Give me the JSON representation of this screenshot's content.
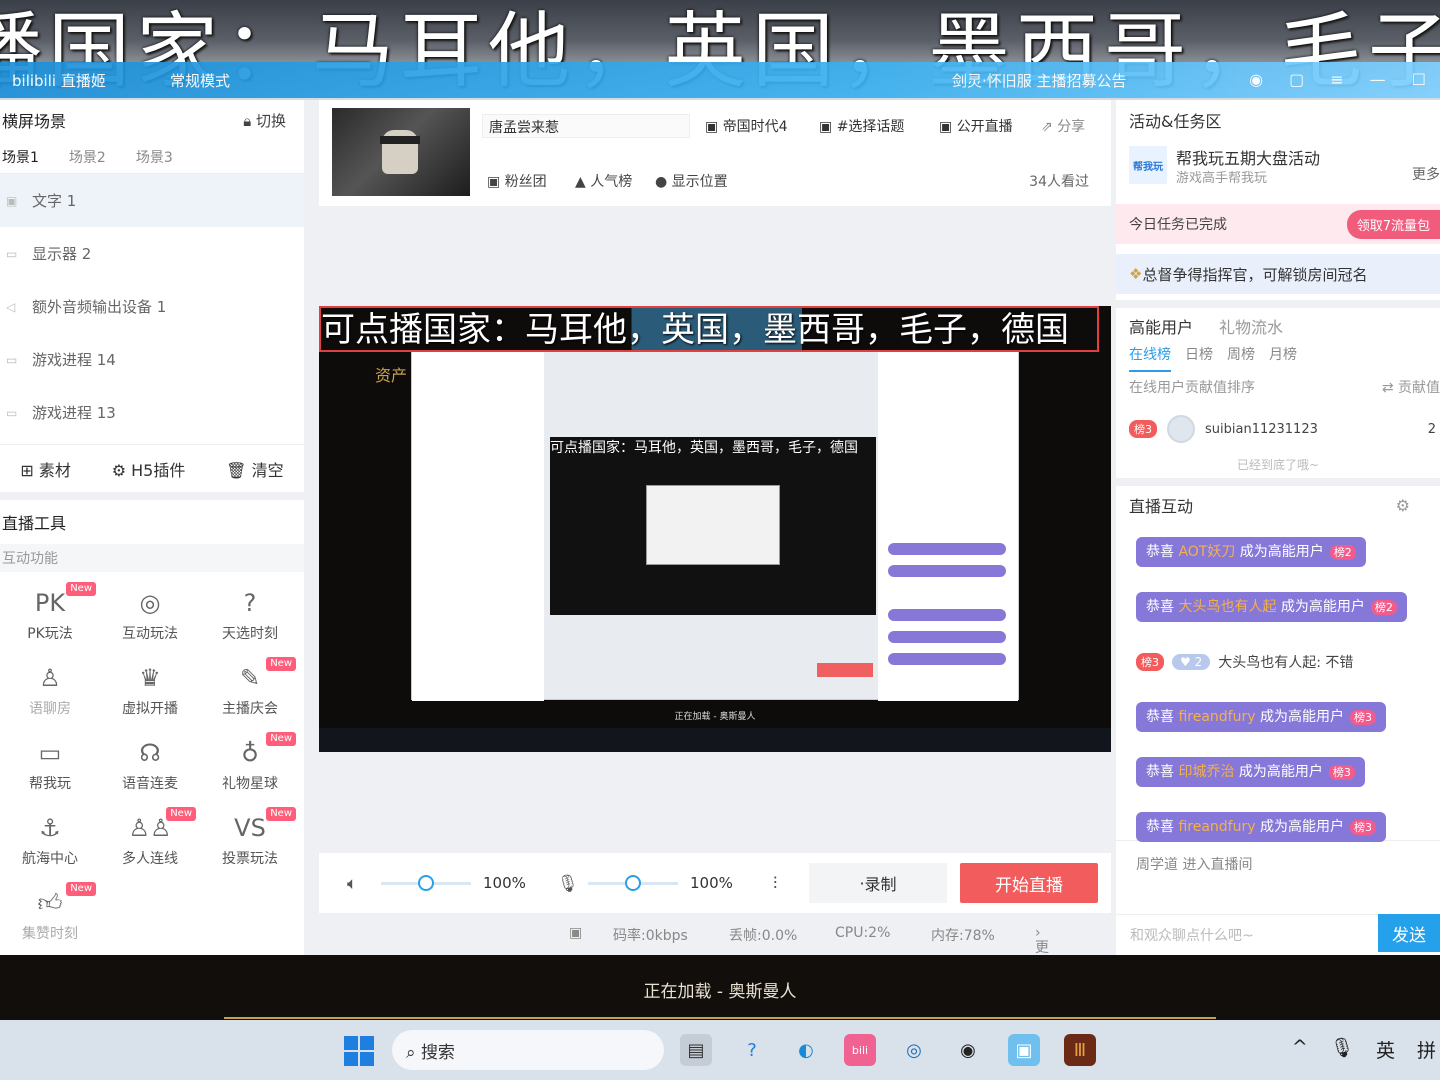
{
  "banner": {
    "text": "播国家：马耳他，英国，墨西哥，毛子，德"
  },
  "titlebar": {
    "app": "bilibili 直播姬",
    "mode": "常规模式",
    "notice": "剑灵·怀旧服 主播招募公告"
  },
  "left": {
    "title": "横屏场景",
    "switch_label": "切换",
    "scenes": [
      "场景1",
      "场景2",
      "场景3"
    ],
    "sources": [
      "文字 1",
      "显示器 2",
      "额外音频输出设备 1",
      "游戏进程 14",
      "游戏进程 13"
    ],
    "buttons": {
      "material": "素材",
      "h5": "H5插件",
      "clear": "清空"
    },
    "tools_title": "直播工具",
    "tools_sub": "互动功能",
    "tools": [
      {
        "label": "PK玩法",
        "icon": "pk-icon",
        "new": "New"
      },
      {
        "label": "互动玩法",
        "icon": "interactive-icon",
        "new": ""
      },
      {
        "label": "天选时刻",
        "icon": "lottery-icon",
        "new": ""
      },
      {
        "label": "语聊房",
        "icon": "voice-room-icon",
        "new": ""
      },
      {
        "label": "虚拟开播",
        "icon": "virtual-icon",
        "new": ""
      },
      {
        "label": "主播庆会",
        "icon": "celebration-icon",
        "new": "New"
      },
      {
        "label": "帮我玩",
        "icon": "gamepad-icon",
        "new": ""
      },
      {
        "label": "语音连麦",
        "icon": "mic-link-icon",
        "new": ""
      },
      {
        "label": "礼物星球",
        "icon": "planet-icon",
        "new": "New"
      },
      {
        "label": "航海中心",
        "icon": "anchor-icon",
        "new": ""
      },
      {
        "label": "多人连线",
        "icon": "multi-user-icon",
        "new": "New"
      },
      {
        "label": "投票玩法",
        "icon": "vote-icon",
        "new": "New"
      },
      {
        "label": "集赞时刻",
        "icon": "thumb-icon",
        "new": "New"
      }
    ]
  },
  "center": {
    "room_title": "唐孟尝来惹",
    "game": "帝国时代4",
    "topic": "#选择话题",
    "public": "公开直播",
    "share": "分享",
    "fans": "粉丝团",
    "rank": "人气榜",
    "location": "显示位置",
    "viewers": "34人看过",
    "caption": "可点播国家：马耳他，英国，墨西哥，毛子，德国",
    "nested_caption": "可点播国家：马耳他，英国，墨西哥，毛子，德国",
    "stage_loading": "正在加载 - 奥斯曼人",
    "stage_side_text": "资产",
    "speaker_pct": "100%",
    "mic_pct": "100%",
    "speaker_level": 0.5,
    "mic_level": 0.5,
    "record": "录制",
    "start_live": "开始直播",
    "bitrate": "码率:0kbps",
    "dropped": "丢帧:0.0%",
    "cpu": "CPU:2%",
    "mem": "内存:78%",
    "more": "更多详情"
  },
  "right": {
    "activity_title": "活动&任务区",
    "act_logo": "帮我玩",
    "act_name": "帮我玩五期大盘活动",
    "act_sub": "游戏高手帮我玩",
    "act_more": "更多",
    "task_done": "今日任务已完成",
    "task_claim": "领取7流量包",
    "commander": "总督争得指挥官，可解锁房间冠名",
    "tabs": [
      "高能用户",
      "礼物流水"
    ],
    "rank_tabs": [
      "在线榜",
      "日榜",
      "周榜",
      "月榜"
    ],
    "rank_head": "在线用户贡献值排序",
    "rank_value": "贡献值",
    "user_badge": "榜3",
    "user_name": "suibian11231123",
    "user_value": "2",
    "bottom_tip": "已经到底了哦~",
    "interact_title": "直播互动",
    "chat": [
      {
        "pre": "恭喜 ",
        "name": "AOT妖刀",
        "post": " 成为高能用户",
        "lv": "榜2"
      },
      {
        "pre": "恭喜 ",
        "name": "大头鸟也有人起",
        "post": " 成为高能用户",
        "lv": "榜2"
      },
      {
        "pre": "恭喜 ",
        "name": "fireandfury",
        "post": " 成为高能用户",
        "lv": "榜3"
      },
      {
        "pre": "恭喜 ",
        "name": "印城乔治",
        "post": " 成为高能用户",
        "lv": "榜3"
      },
      {
        "pre": "恭喜 ",
        "name": "fireandfury",
        "post": " 成为高能用户",
        "lv": "榜3"
      }
    ],
    "plain_chat": {
      "badge": "榜3",
      "level": "2",
      "text": "大头鸟也有人起: 不错"
    },
    "enter": "周学道 进入直播间",
    "input_placeholder": "和观众聊点什么吧~",
    "send": "发送"
  },
  "lower": {
    "loading": "正在加载 - 奥斯曼人",
    "search": "搜索",
    "tray": [
      "^",
      "英",
      "拼"
    ]
  }
}
